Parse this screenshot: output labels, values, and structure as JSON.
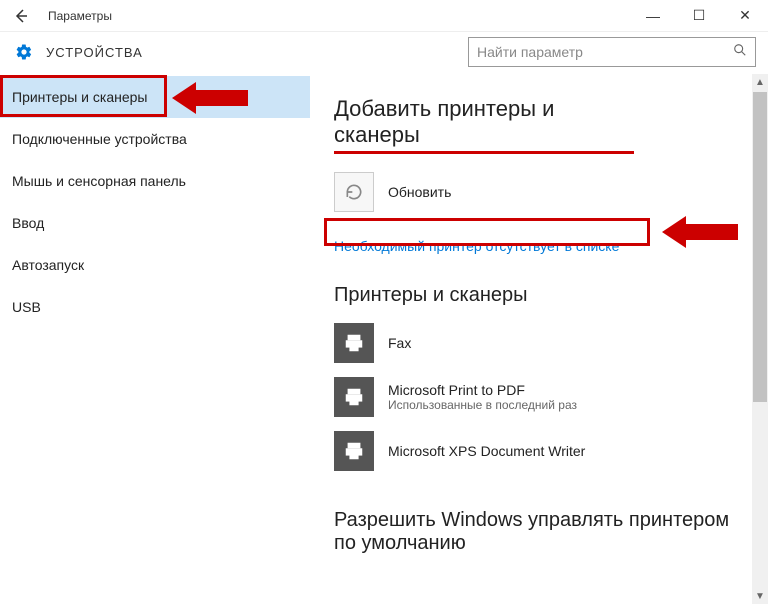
{
  "window": {
    "title": "Параметры",
    "controls": {
      "min": "—",
      "max": "☐",
      "close": "✕"
    }
  },
  "header": {
    "title": "УСТРОЙСТВА",
    "search_placeholder": "Найти параметр"
  },
  "sidebar": {
    "items": [
      {
        "label": "Принтеры и сканеры",
        "active": true
      },
      {
        "label": "Подключенные устройства",
        "active": false
      },
      {
        "label": "Мышь и сенсорная панель",
        "active": false
      },
      {
        "label": "Ввод",
        "active": false
      },
      {
        "label": "Автозапуск",
        "active": false
      },
      {
        "label": "USB",
        "active": false
      }
    ]
  },
  "main": {
    "add_section": {
      "heading": "Добавить принтеры и сканеры",
      "refresh_label": "Обновить",
      "missing_link": "Необходимый принтер отсутствует в списке"
    },
    "printers_section": {
      "heading": "Принтеры и сканеры",
      "items": [
        {
          "name": "Fax",
          "sub": ""
        },
        {
          "name": "Microsoft Print to PDF",
          "sub": "Использованные в последний раз"
        },
        {
          "name": "Microsoft XPS Document Writer",
          "sub": ""
        }
      ]
    },
    "default_section": {
      "heading": "Разрешить Windows управлять принтером по умолчанию"
    }
  },
  "annotations": {
    "color": "#c00"
  }
}
